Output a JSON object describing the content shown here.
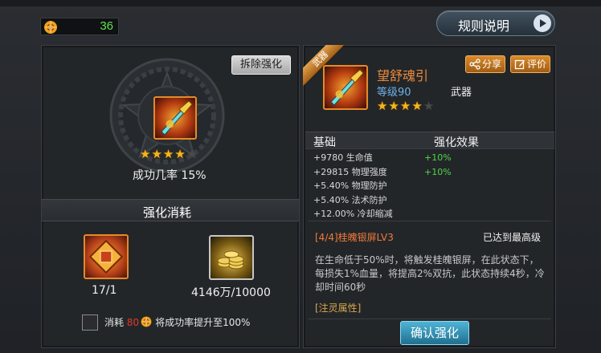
{
  "currency": {
    "amount": "36",
    "icon": "sun-token-icon"
  },
  "rules_button": {
    "label": "规则说明"
  },
  "left_panel": {
    "dismantle_label": "拆除强化",
    "stars_on": 4,
    "stars_total": 5,
    "success_rate": "成功几率 15%",
    "cost_title": "强化消耗",
    "materials": [
      {
        "name": "enhance-stone",
        "count": "17/1"
      },
      {
        "name": "gold-coins",
        "count": "4146万/10000"
      }
    ],
    "consume_prefix": "消耗",
    "consume_amount": "80",
    "consume_suffix": "将成功率提升至100%"
  },
  "item": {
    "ribbon": "武器",
    "name": "望舒魂引",
    "level": "等级90",
    "type": "武器",
    "stars_on": 4,
    "stars_total": 5,
    "share_label": "分享",
    "review_label": "评价"
  },
  "stats": {
    "header_base": "基础",
    "header_effect": "强化效果",
    "rows": [
      {
        "base": "+9780 生命值",
        "effect": "+10%"
      },
      {
        "base": "+29815 物理强度",
        "effect": "+10%"
      },
      {
        "base": "+5.40% 物理防护",
        "effect": ""
      },
      {
        "base": "+5.40% 法术防护",
        "effect": ""
      },
      {
        "base": "+12.00% 冷却缩减",
        "effect": ""
      }
    ]
  },
  "skill": {
    "name": "[4/4]桂魄银屏LV3",
    "max_label": "已达到最高级",
    "description": "在生命低于50%时，将触发桂魄银屏，在此状态下，每损失1%血量，将提高2%双抗，此状态持续4秒，冷却时间60秒",
    "spirit_label": "[注灵属性]"
  },
  "confirm_button": {
    "label": "确认强化"
  },
  "colors": {
    "accent_orange": "#e58a2a",
    "green": "#5fe04f",
    "skill_orange": "#f07a3a",
    "confirm_blue": "#4fb4d6"
  }
}
